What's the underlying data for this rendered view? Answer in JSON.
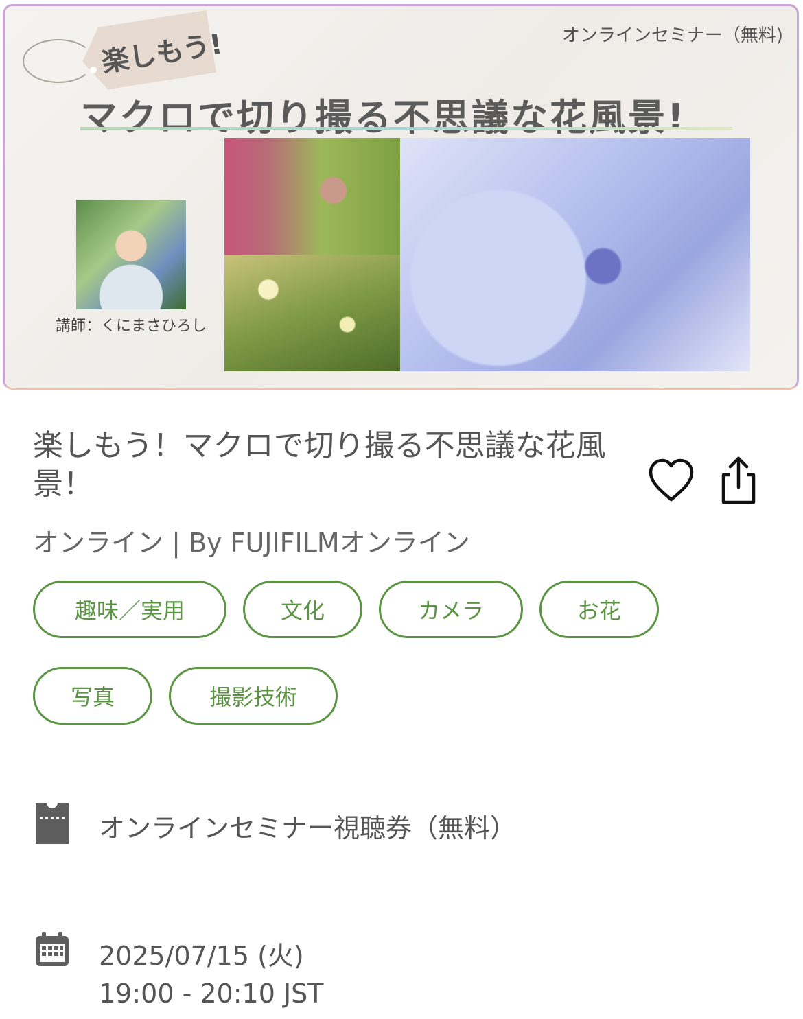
{
  "banner": {
    "tag_text": "楽しもう!",
    "badge": "オンラインセミナー（無料)",
    "title": "マクロで切り撮る不思議な花風景!",
    "instructor_caption": "講師：くにまさひろし"
  },
  "event": {
    "title": "楽しもう！マクロで切り撮る不思議な花風景！",
    "meta": "オンライン | By FUJIFILMオンライン"
  },
  "tags": [
    "趣味／実用",
    "文化",
    "カメラ",
    "お花",
    "写真",
    "撮影技術"
  ],
  "ticket": {
    "label": "オンラインセミナー視聴券（無料）",
    "icon": "ticket-icon"
  },
  "schedule": {
    "date": "2025/07/15 (火)",
    "time": "19:00 - 20:10 JST",
    "icon": "calendar-icon"
  },
  "colors": {
    "accent": "#5b9443",
    "text": "#555555",
    "icon": "#5e5e5e"
  }
}
